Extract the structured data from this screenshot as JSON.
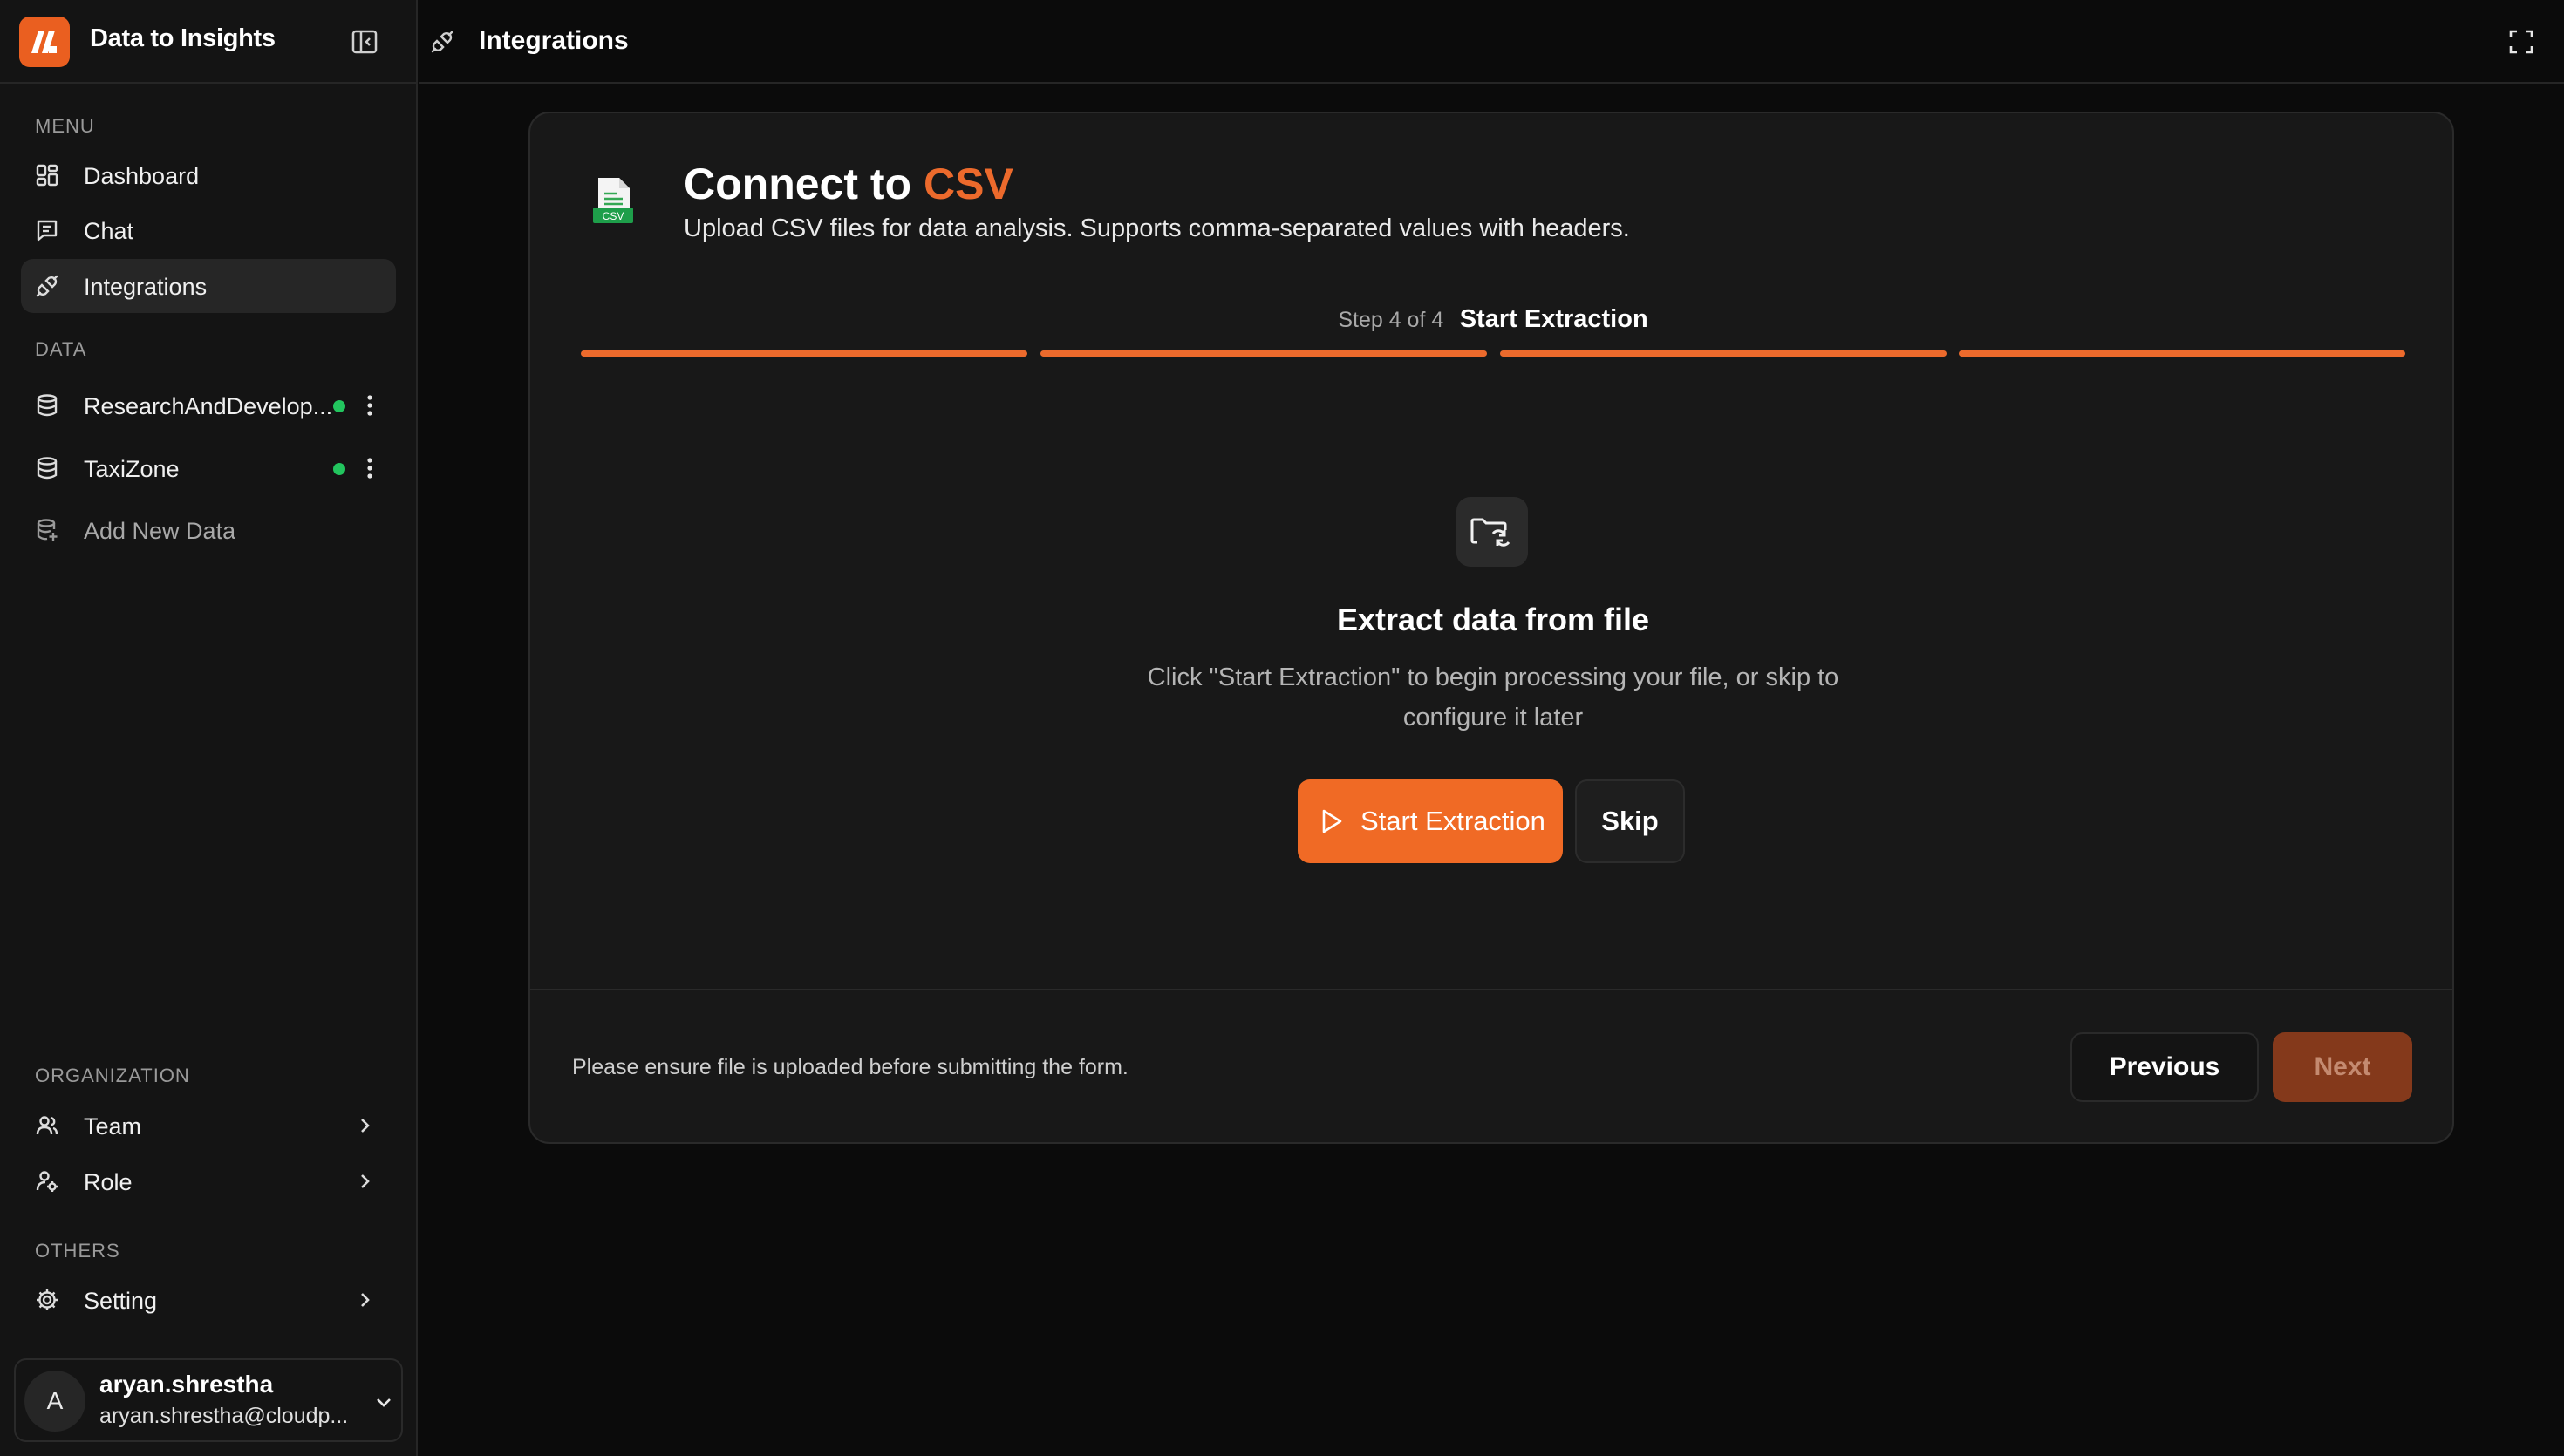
{
  "app": {
    "title": "Data to Insights"
  },
  "sidebar": {
    "menu_label": "MENU",
    "menu_items": [
      {
        "label": "Dashboard",
        "icon": "dashboard-icon"
      },
      {
        "label": "Chat",
        "icon": "chat-icon"
      },
      {
        "label": "Integrations",
        "icon": "plug-icon",
        "active": true
      }
    ],
    "data_label": "DATA",
    "data_items": [
      {
        "label": "ResearchAndDevelop...",
        "icon": "database-icon",
        "status": "connected"
      },
      {
        "label": "TaxiZone",
        "icon": "database-icon",
        "status": "connected"
      }
    ],
    "add_data_label": "Add New Data",
    "org_label": "ORGANIZATION",
    "org_items": [
      {
        "label": "Team",
        "icon": "users-icon"
      },
      {
        "label": "Role",
        "icon": "user-role-icon"
      }
    ],
    "others_label": "OTHERS",
    "others_items": [
      {
        "label": "Setting",
        "icon": "gear-icon"
      }
    ],
    "user": {
      "initial": "A",
      "name": "aryan.shrestha",
      "email": "aryan.shrestha@cloudp..."
    }
  },
  "topbar": {
    "title": "Integrations"
  },
  "connect": {
    "title_prefix": "Connect to ",
    "title_accent": "CSV",
    "file_badge": "CSV",
    "description": "Upload CSV files for data analysis. Supports comma-separated values with headers.",
    "step_count": "Step 4 of 4",
    "step_name": "Start Extraction",
    "progress": {
      "completed_steps": 4,
      "total_steps": 4
    },
    "extract_title": "Extract data from file",
    "extract_desc": "Click \"Start Extraction\" to begin processing your file, or skip to configure it later",
    "start_label": "Start Extraction",
    "skip_label": "Skip",
    "footer_note": "Please ensure file is uploaded before submitting the form.",
    "previous_label": "Previous",
    "next_label": "Next"
  },
  "colors": {
    "accent": "#ec6a2c",
    "status_green": "#22c55e",
    "background": "#0b0b0b",
    "card": "#181818"
  }
}
